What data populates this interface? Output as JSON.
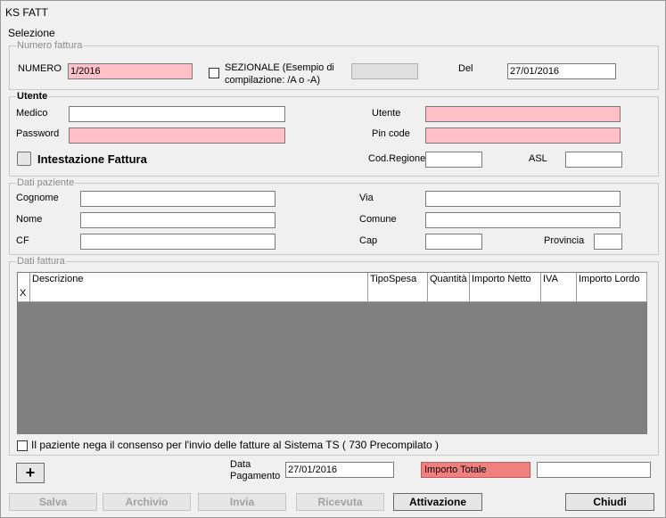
{
  "window": {
    "title": "KS FATT"
  },
  "menu": {
    "item": "Selezione"
  },
  "invoice_group": {
    "legend": "Numero fattura",
    "numero_label": "NUMERO",
    "numero_value": "1/2016",
    "sezionale_label_1": "SEZIONALE (Esempio di",
    "sezionale_label_2": "compilazione: /A o -A)",
    "sezionale_value": "",
    "del_label": "Del",
    "del_value": "27/01/2016"
  },
  "user_group": {
    "legend": "Utente",
    "medico_label": "Medico",
    "medico_value": "",
    "password_label": "Password",
    "password_value": "",
    "utente_label": "Utente",
    "utente_value": "",
    "pin_label": "Pin code",
    "pin_value": "",
    "intestazione_label": "Intestazione Fattura",
    "codregione_label": "Cod.Regione",
    "codregione_value": "",
    "asl_label": "ASL",
    "asl_value": ""
  },
  "patient_group": {
    "legend": "Dati paziente",
    "cognome_label": "Cognome",
    "nome_label": "Nome",
    "cf_label": "CF",
    "via_label": "Via",
    "comune_label": "Comune",
    "cap_label": "Cap",
    "provincia_label": "Provincia"
  },
  "invoice_data_group": {
    "legend": "Dati fattura",
    "columns": [
      "Descrizione",
      "TipoSpesa",
      "Quantità",
      "Importo Netto",
      "IVA",
      "Importo Lordo"
    ],
    "row_marker": "X"
  },
  "consent": {
    "label": "Il paziente nega il consenso per l'invio delle fatture al Sistema TS  ( 730 Precompilato )"
  },
  "payment": {
    "add_symbol": "+",
    "data_label_1": "Data",
    "data_label_2": "Pagamento",
    "data_value": "27/01/2016",
    "total_label": "Importo Totale",
    "total_value": ""
  },
  "buttons": {
    "salva": "Salva",
    "archivio": "Archivio",
    "invia": "Invia",
    "ricevuta": "Ricevuta",
    "attivazione": "Attivazione",
    "chiudi": "Chiudi"
  }
}
